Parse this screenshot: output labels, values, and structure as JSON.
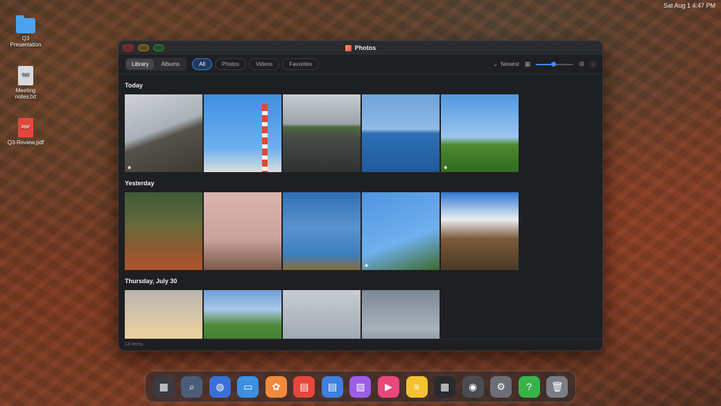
{
  "menubar": {
    "clock": "Sat Aug 1  4:47 PM"
  },
  "desktop": {
    "icons": [
      {
        "label": "Q3 Presentation",
        "type": "folder"
      },
      {
        "label": "Meeting notes.txt",
        "type": "TXT"
      },
      {
        "label": "Q3-Review.pdf",
        "type": "PDF"
      }
    ]
  },
  "window": {
    "title": "Photos",
    "view_tabs": [
      "Library",
      "Albums"
    ],
    "active_view": "Library",
    "filters": [
      "All",
      "Photos",
      "Videos",
      "Favorites"
    ],
    "active_filter": "All",
    "sort_label": "Newest",
    "zoom_level": 0.45,
    "sections": [
      {
        "title": "Today",
        "photo_count": 5,
        "favorites": [
          0,
          4
        ]
      },
      {
        "title": "Yesterday",
        "photo_count": 5,
        "favorites": [
          3
        ]
      },
      {
        "title": "Thursday, July 30",
        "photo_count": 4,
        "favorites": []
      }
    ],
    "status": "14 items"
  },
  "dock": {
    "items": [
      {
        "name": "launchpad-icon",
        "glyph": "▦",
        "color": "#3a3a42"
      },
      {
        "name": "finder-search-icon",
        "glyph": "⌕",
        "color": "#4a5d78"
      },
      {
        "name": "browser-icon",
        "glyph": "◍",
        "color": "#3b6fd8"
      },
      {
        "name": "files-icon",
        "glyph": "▭",
        "color": "#3d8fe0"
      },
      {
        "name": "photos-icon",
        "glyph": "✿",
        "color": "#f08a3c"
      },
      {
        "name": "pdf-icon",
        "glyph": "▤",
        "color": "#e5483b"
      },
      {
        "name": "docs-icon",
        "glyph": "▤",
        "color": "#3f7fe0"
      },
      {
        "name": "gallery-icon",
        "glyph": "▨",
        "color": "#9b5de5"
      },
      {
        "name": "media-player-icon",
        "glyph": "▶",
        "color": "#e8477a"
      },
      {
        "name": "notes-icon",
        "glyph": "≡",
        "color": "#f2c230"
      },
      {
        "name": "calculator-icon",
        "glyph": "▦",
        "color": "#2a2a2e"
      },
      {
        "name": "camera-icon",
        "glyph": "◉",
        "color": "#4a4c52"
      },
      {
        "name": "settings-icon",
        "glyph": "⚙",
        "color": "#6c6f76"
      },
      {
        "name": "help-icon",
        "glyph": "?",
        "color": "#38b34a"
      },
      {
        "name": "trash-icon",
        "glyph": "🗑",
        "color": "#7a7d84"
      }
    ]
  }
}
